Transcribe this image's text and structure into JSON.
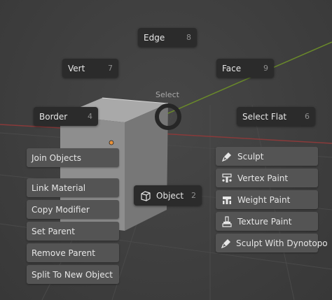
{
  "pie": {
    "title": "Select",
    "items": {
      "edge": {
        "label": "Edge",
        "key": "8"
      },
      "vert": {
        "label": "Vert",
        "key": "7"
      },
      "face": {
        "label": "Face",
        "key": "9"
      },
      "border": {
        "label": "Border",
        "key": "4"
      },
      "select_flat": {
        "label": "Select Flat",
        "key": "6"
      },
      "object": {
        "label": "Object",
        "key": "2"
      }
    }
  },
  "left_menu": [
    "Join Objects",
    "Link Material",
    "Copy Modifier",
    "Set Parent",
    "Remove Parent",
    "Split To New Object"
  ],
  "right_menu": [
    {
      "label": "Sculpt",
      "icon": "sculpt-brush-icon"
    },
    {
      "label": "Vertex Paint",
      "icon": "vertex-paint-icon"
    },
    {
      "label": "Weight Paint",
      "icon": "weight-paint-icon"
    },
    {
      "label": "Texture Paint",
      "icon": "texture-paint-icon"
    },
    {
      "label": "Sculpt With Dynotopo",
      "icon": "sculpt-brush-icon"
    }
  ],
  "colors": {
    "x_axis": "#8a3a3a",
    "y_axis": "#6a8a2a",
    "pie_button_bg": "#2b2b2b",
    "menu_button_bg": "#545454",
    "origin": "#e8923a"
  }
}
